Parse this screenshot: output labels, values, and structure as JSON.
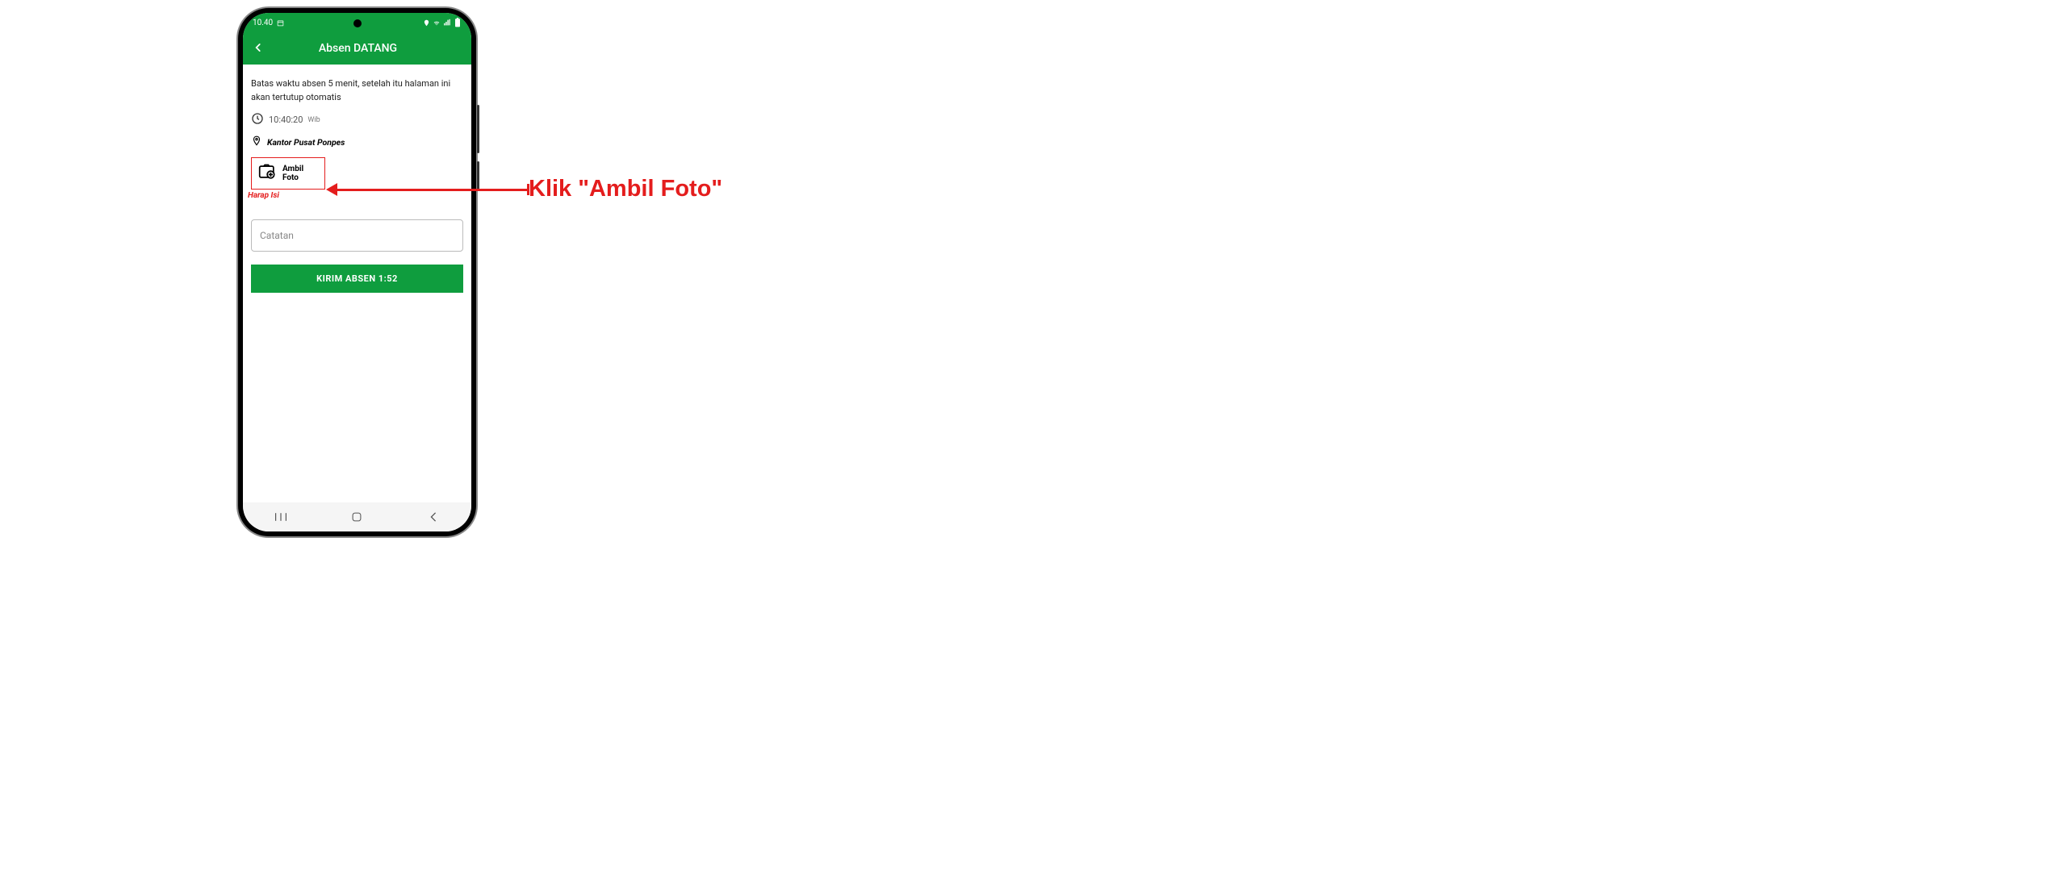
{
  "status": {
    "time": "10.40",
    "calendar_icon": "▦"
  },
  "header": {
    "title": "Absen DATANG"
  },
  "content": {
    "info": "Batas waktu absen 5 menit, setelah itu halaman ini akan tertutup otomatis",
    "time_value": "10:40:20",
    "time_suffix": "Wib",
    "location": "Kantor Pusat Ponpes",
    "photo_label": "Ambil Foto",
    "validation": "Harap Isi",
    "catatan_placeholder": "Catatan",
    "submit_label": "KIRIM ABSEN 1:52"
  },
  "annotation": {
    "text": "Klik \"Ambil Foto\""
  }
}
